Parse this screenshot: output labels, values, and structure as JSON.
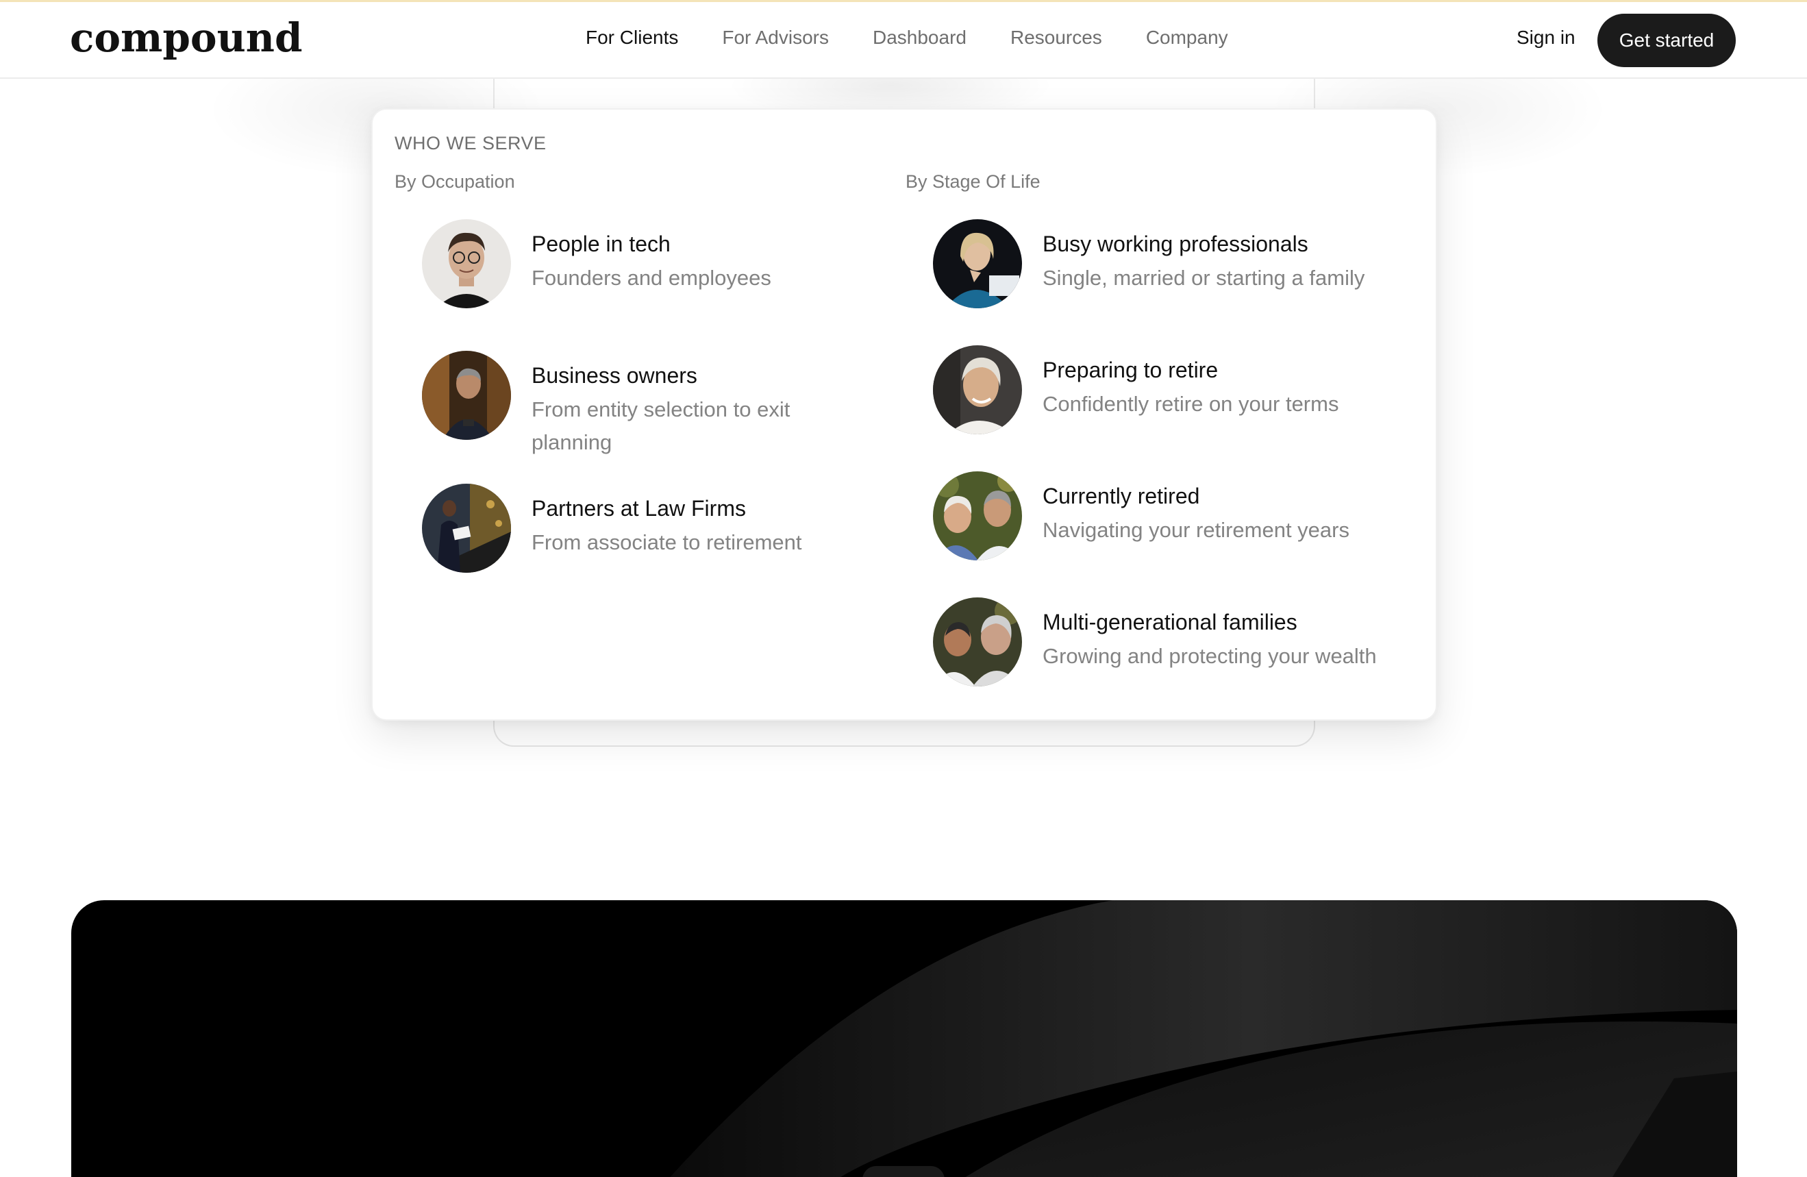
{
  "header": {
    "logo": "compound",
    "nav": [
      "For Clients",
      "For Advisors",
      "Dashboard",
      "Resources",
      "Company"
    ],
    "active_nav": "For Clients",
    "sign_in": "Sign in",
    "cta": "Get started"
  },
  "dropdown": {
    "heading": "WHO WE SERVE",
    "occupation": {
      "title": "By Occupation",
      "items": [
        {
          "title": "People in tech",
          "desc": "Founders and employees"
        },
        {
          "title": "Business owners",
          "desc": "From entity selection to exit planning"
        },
        {
          "title": "Partners at Law Firms",
          "desc": "From associate to retirement"
        }
      ]
    },
    "stage": {
      "title": "By Stage Of Life",
      "items": [
        {
          "title": "Busy working professionals",
          "desc": "Single, married or starting a family"
        },
        {
          "title": "Preparing to retire",
          "desc": "Confidently retire on your terms"
        },
        {
          "title": "Currently retired",
          "desc": "Navigating your retirement years"
        },
        {
          "title": "Multi-generational families",
          "desc": "Growing and protecting your wealth"
        }
      ]
    }
  },
  "colors": {
    "accent_line": "#f4e4b8",
    "cta_bg": "#1b1b1b",
    "hero_bg": "#000000"
  }
}
